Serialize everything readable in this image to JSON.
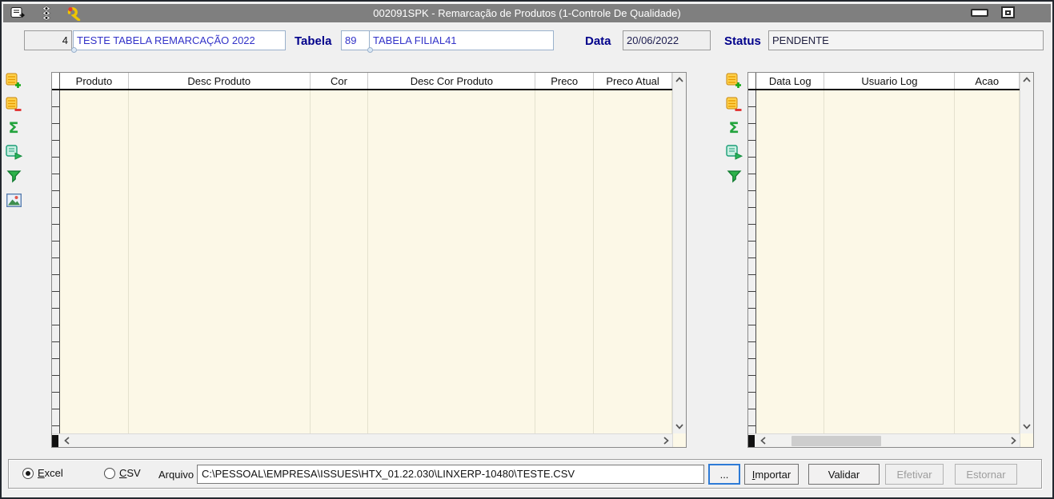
{
  "window": {
    "title": "002091SPK - Remarcação de Produtos (1-Controle De Qualidade)",
    "titlebar_icons": [
      "form-export-icon",
      "traffic-light-icon",
      "wrench-icon"
    ],
    "window_buttons": [
      "minimize",
      "maximize"
    ]
  },
  "header": {
    "id_value": "4",
    "name_value": "TESTE TABELA REMARCAÇÃO 2022",
    "tabela_label": "Tabela",
    "tabela_code": "89",
    "tabela_desc": "TABELA FILIAL41",
    "data_label": "Data",
    "data_value": "20/06/2022",
    "status_label": "Status",
    "status_value": "PENDENTE"
  },
  "toolbar_icons": [
    "add-row-icon",
    "delete-row-icon",
    "sum-icon",
    "export-grid-icon",
    "filter-icon",
    "image-icon"
  ],
  "products_grid": {
    "columns": [
      "Produto",
      "Desc Produto",
      "Cor",
      "Desc Cor Produto",
      "Preco",
      "Preco Atual"
    ],
    "rows": []
  },
  "log_grid": {
    "columns": [
      "Data Log",
      "Usuario Log",
      "Acao"
    ],
    "rows": []
  },
  "footer": {
    "radio_excel": "Excel",
    "radio_csv": "CSV",
    "selected_format": "Excel",
    "arquivo_label": "Arquivo",
    "file_path": "C:\\PESSOAL\\EMPRESA\\ISSUES\\HTX_01.22.030\\LINXERP-10480\\TESTE.CSV",
    "browse_label": "...",
    "importar_label": "Importar",
    "validar_label": "Validar",
    "efetivar_label": "Efetivar",
    "estornar_label": "Estornar",
    "efetivar_enabled": false,
    "estornar_enabled": false
  },
  "colors": {
    "titlebar": "#7F7F7F",
    "window_bg": "#F0F0F0",
    "grid_body": "#FCF8E7",
    "label_navy": "#00008B",
    "value_blue": "#3232C8",
    "focus_blue": "#2E7BD6"
  }
}
